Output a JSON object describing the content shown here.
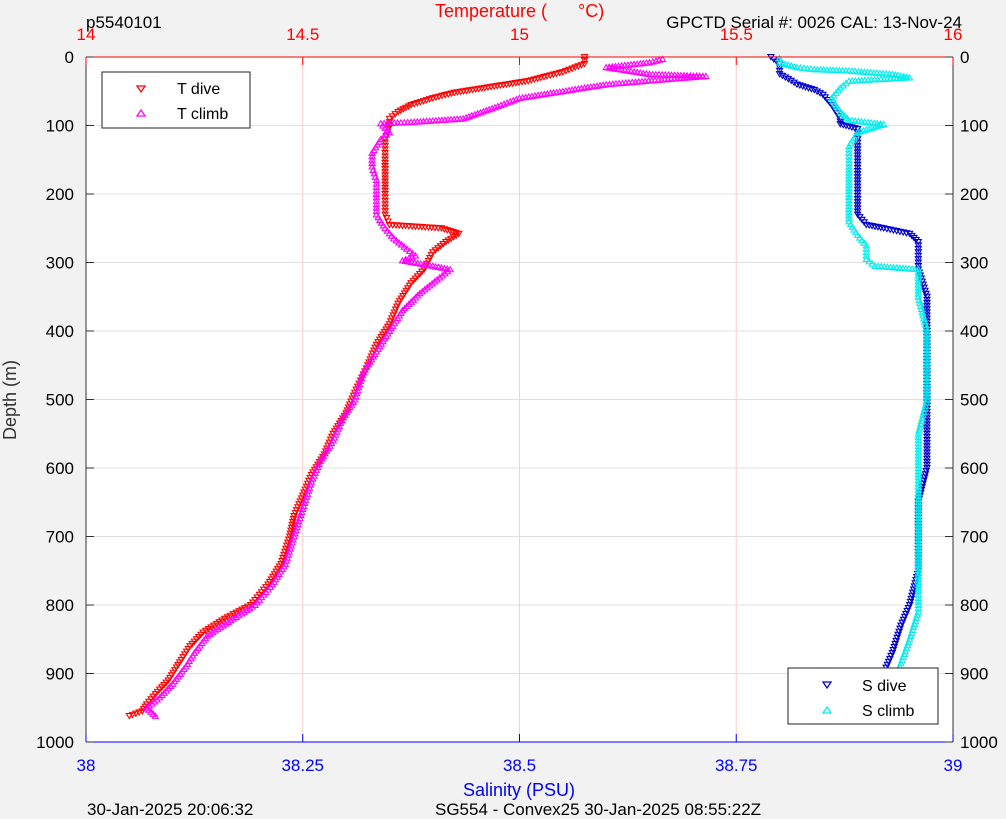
{
  "header": {
    "profile_id": "p5540101",
    "sensor_info": "GPCTD Serial #: 0026 CAL: 13-Nov-24"
  },
  "footer": {
    "plot_time": "30-Jan-2025 20:06:32",
    "mission": "SG554 - Convex25 30-Jan-2025 08:55:22Z"
  },
  "colors": {
    "temperature_axis": "#ff0000",
    "salinity_axis": "#0000ff",
    "t_dive": "#ff0000",
    "t_climb": "#ff00ff",
    "s_dive": "#0000cc",
    "s_climb": "#00eeee",
    "grid": "#e0e0e0",
    "temp_grid": "#ffcccc"
  },
  "chart_data": {
    "type": "scatter",
    "title": "",
    "ylabel": "Depth (m)",
    "ylim": [
      1000,
      0
    ],
    "yticks": [
      0,
      100,
      200,
      300,
      400,
      500,
      600,
      700,
      800,
      900,
      1000
    ],
    "grid": true,
    "top_axis": {
      "label_part1": "Temperature (",
      "label_part2": "°C)",
      "lim": [
        14,
        16
      ],
      "ticks": [
        14,
        14.5,
        15,
        15.5,
        16
      ],
      "tick_labels": [
        "14",
        "14.5",
        "15",
        "15.5",
        "16"
      ]
    },
    "bottom_axis": {
      "label": "Salinity (PSU)",
      "lim": [
        38,
        39
      ],
      "ticks": [
        38,
        38.25,
        38.5,
        38.75,
        39
      ],
      "tick_labels": [
        "38",
        "38.25",
        "38.5",
        "38.75",
        "39"
      ]
    },
    "legends": [
      {
        "position": "top-left",
        "entries": [
          "T dive",
          "T climb"
        ]
      },
      {
        "position": "bottom-right",
        "entries": [
          "S dive",
          "S climb"
        ]
      }
    ],
    "series": [
      {
        "name": "T dive",
        "axis": "temperature",
        "marker": "triangle-down",
        "color": "#ff0000",
        "points": [
          [
            15.15,
            0
          ],
          [
            15.15,
            10
          ],
          [
            15.1,
            22
          ],
          [
            15.02,
            35
          ],
          [
            14.92,
            45
          ],
          [
            14.85,
            52
          ],
          [
            14.8,
            60
          ],
          [
            14.75,
            70
          ],
          [
            14.72,
            80
          ],
          [
            14.7,
            90
          ],
          [
            14.7,
            100
          ],
          [
            14.69,
            120
          ],
          [
            14.69,
            150
          ],
          [
            14.69,
            200
          ],
          [
            14.69,
            230
          ],
          [
            14.7,
            245
          ],
          [
            14.82,
            250
          ],
          [
            14.86,
            258
          ],
          [
            14.83,
            270
          ],
          [
            14.8,
            285
          ],
          [
            14.78,
            310
          ],
          [
            14.75,
            330
          ],
          [
            14.72,
            360
          ],
          [
            14.7,
            390
          ],
          [
            14.67,
            420
          ],
          [
            14.65,
            450
          ],
          [
            14.62,
            490
          ],
          [
            14.6,
            520
          ],
          [
            14.57,
            550
          ],
          [
            14.55,
            580
          ],
          [
            14.52,
            610
          ],
          [
            14.5,
            640
          ],
          [
            14.48,
            670
          ],
          [
            14.47,
            700
          ],
          [
            14.45,
            740
          ],
          [
            14.42,
            770
          ],
          [
            14.38,
            800
          ],
          [
            14.32,
            820
          ],
          [
            14.27,
            840
          ],
          [
            14.24,
            860
          ],
          [
            14.22,
            880
          ],
          [
            14.19,
            910
          ],
          [
            14.16,
            930
          ],
          [
            14.14,
            945
          ],
          [
            14.13,
            955
          ],
          [
            14.1,
            962
          ]
        ]
      },
      {
        "name": "T climb",
        "axis": "temperature",
        "marker": "triangle-up",
        "color": "#ff00ff",
        "points": [
          [
            14.16,
            962
          ],
          [
            14.14,
            950
          ],
          [
            14.17,
            935
          ],
          [
            14.2,
            915
          ],
          [
            14.23,
            890
          ],
          [
            14.25,
            870
          ],
          [
            14.28,
            845
          ],
          [
            14.34,
            820
          ],
          [
            14.39,
            800
          ],
          [
            14.43,
            770
          ],
          [
            14.46,
            740
          ],
          [
            14.48,
            700
          ],
          [
            14.5,
            660
          ],
          [
            14.52,
            620
          ],
          [
            14.54,
            590
          ],
          [
            14.57,
            560
          ],
          [
            14.59,
            530
          ],
          [
            14.62,
            500
          ],
          [
            14.64,
            460
          ],
          [
            14.67,
            430
          ],
          [
            14.7,
            400
          ],
          [
            14.73,
            370
          ],
          [
            14.77,
            345
          ],
          [
            14.81,
            325
          ],
          [
            14.84,
            310
          ],
          [
            14.8,
            305
          ],
          [
            14.73,
            297
          ],
          [
            14.76,
            290
          ],
          [
            14.74,
            280
          ],
          [
            14.71,
            265
          ],
          [
            14.69,
            250
          ],
          [
            14.67,
            230
          ],
          [
            14.67,
            200
          ],
          [
            14.67,
            180
          ],
          [
            14.66,
            160
          ],
          [
            14.66,
            140
          ],
          [
            14.68,
            120
          ],
          [
            14.7,
            110
          ],
          [
            14.68,
            97
          ],
          [
            14.75,
            95
          ],
          [
            14.8,
            93
          ],
          [
            14.87,
            90
          ],
          [
            14.95,
            72
          ],
          [
            15.0,
            60
          ],
          [
            15.1,
            50
          ],
          [
            15.2,
            40
          ],
          [
            15.35,
            32
          ],
          [
            15.43,
            28
          ],
          [
            15.3,
            25
          ],
          [
            15.2,
            15
          ],
          [
            15.3,
            8
          ],
          [
            15.33,
            3
          ]
        ]
      },
      {
        "name": "S dive",
        "axis": "salinity",
        "marker": "triangle-down",
        "color": "#0000cc",
        "points": [
          [
            38.79,
            0
          ],
          [
            38.8,
            10
          ],
          [
            38.8,
            25
          ],
          [
            38.81,
            32
          ],
          [
            38.82,
            40
          ],
          [
            38.84,
            48
          ],
          [
            38.85,
            55
          ],
          [
            38.86,
            70
          ],
          [
            38.87,
            90
          ],
          [
            38.87,
            98
          ],
          [
            38.89,
            105
          ],
          [
            38.89,
            130
          ],
          [
            38.89,
            180
          ],
          [
            38.89,
            230
          ],
          [
            38.9,
            245
          ],
          [
            38.92,
            250
          ],
          [
            38.95,
            258
          ],
          [
            38.96,
            270
          ],
          [
            38.96,
            290
          ],
          [
            38.96,
            310
          ],
          [
            38.97,
            350
          ],
          [
            38.97,
            400
          ],
          [
            38.97,
            450
          ],
          [
            38.97,
            500
          ],
          [
            38.97,
            550
          ],
          [
            38.97,
            600
          ],
          [
            38.96,
            650
          ],
          [
            38.96,
            700
          ],
          [
            38.96,
            750
          ],
          [
            38.95,
            800
          ],
          [
            38.94,
            830
          ],
          [
            38.93,
            870
          ],
          [
            38.92,
            900
          ],
          [
            38.91,
            930
          ],
          [
            38.91,
            950
          ],
          [
            38.91,
            962
          ]
        ]
      },
      {
        "name": "S climb",
        "axis": "salinity",
        "marker": "triangle-up",
        "color": "#00eeee",
        "points": [
          [
            38.92,
            962
          ],
          [
            38.92,
            945
          ],
          [
            38.93,
            915
          ],
          [
            38.94,
            885
          ],
          [
            38.95,
            850
          ],
          [
            38.96,
            810
          ],
          [
            38.96,
            780
          ],
          [
            38.96,
            740
          ],
          [
            38.96,
            700
          ],
          [
            38.96,
            650
          ],
          [
            38.96,
            600
          ],
          [
            38.96,
            550
          ],
          [
            38.97,
            500
          ],
          [
            38.97,
            450
          ],
          [
            38.97,
            400
          ],
          [
            38.96,
            350
          ],
          [
            38.96,
            310
          ],
          [
            38.91,
            305
          ],
          [
            38.9,
            295
          ],
          [
            38.9,
            275
          ],
          [
            38.89,
            260
          ],
          [
            38.88,
            240
          ],
          [
            38.88,
            200
          ],
          [
            38.88,
            160
          ],
          [
            38.88,
            130
          ],
          [
            38.89,
            110
          ],
          [
            38.92,
            98
          ],
          [
            38.88,
            92
          ],
          [
            38.87,
            80
          ],
          [
            38.86,
            60
          ],
          [
            38.87,
            45
          ],
          [
            38.88,
            35
          ],
          [
            38.95,
            30
          ],
          [
            38.93,
            25
          ],
          [
            38.88,
            20
          ],
          [
            38.84,
            18
          ],
          [
            38.82,
            15
          ],
          [
            38.8,
            8
          ],
          [
            38.8,
            2
          ]
        ]
      }
    ]
  }
}
